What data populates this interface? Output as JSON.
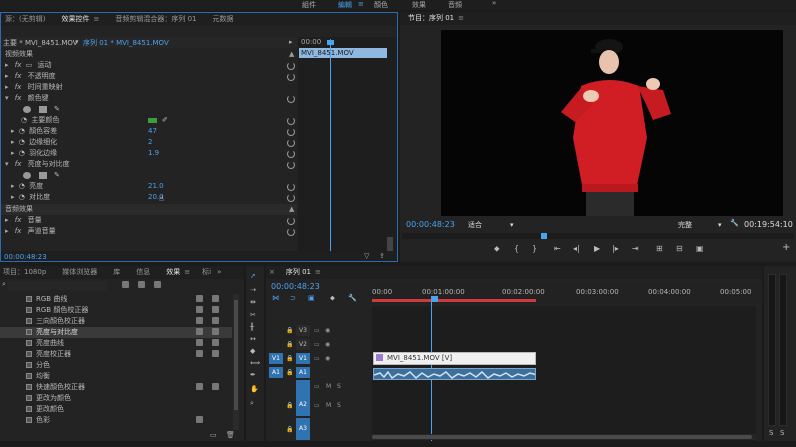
{
  "topbar": {
    "items": [
      "組件",
      "編輯",
      "顏色",
      "效果",
      "音頻"
    ],
    "active": "編輯",
    "more": "»"
  },
  "effect_controls": {
    "tabs": [
      "源：(无剪辑)",
      "效果控件",
      "音频剪辑混合器：序列 01",
      "元数据"
    ],
    "clip_master": "主要 * MVI_8451.MOV",
    "clip_sequence": "序列 01 * MVI_8451.MOV",
    "mini_time": "00:00",
    "mini_clip": "MVI_8451.MOV",
    "section_video": "视频效果",
    "motion": "运动",
    "opacity": "不透明度",
    "time_remap": "时间重映射",
    "color_key": "颜色键",
    "key_color": "主要颜色",
    "color_tolerance": "顏色容差",
    "color_tolerance_val": "47",
    "edge_thin": "边缘细化",
    "edge_thin_val": "2",
    "feather": "羽化边缘",
    "feather_val": "1.9",
    "bc": "亮度与对比度",
    "brightness": "亮度",
    "brightness_val": "21.0",
    "contrast": "对比度",
    "contrast_val": "20.0",
    "section_audio": "音频效果",
    "volume": "音量",
    "channel_volume": "声道音量",
    "timecode": "00:00:48:23"
  },
  "program": {
    "tab": "节目：序列 01",
    "timecode": "00:00:48:23",
    "fit": "适合",
    "quality": "完整",
    "duration": "00:19:54:10"
  },
  "project": {
    "tabs": [
      "项目：1080p",
      "媒体浏览器",
      "库",
      "信息",
      "效果",
      "标i"
    ],
    "search_placeholder": "",
    "items": [
      "RGB 曲线",
      "RGB 顏色校正器",
      "三向顏色校正器",
      "亮度与对比度",
      "亮度曲线",
      "亮度校正器",
      "分色",
      "均衡",
      "快速顏色校正器",
      "更改为颜色",
      "更改颜色",
      "色彩"
    ]
  },
  "timeline": {
    "tab": "序列 01",
    "timecode": "00:00:48:23",
    "ruler": [
      "00:00",
      "00:01:00:00",
      "00:02:00:00",
      "00:03:00:00",
      "00:04:00:00",
      "00:05:00"
    ],
    "tracks_video": [
      "V3",
      "V2",
      "V1"
    ],
    "tracks_audio": [
      "A1",
      "A2",
      "A3"
    ],
    "src_v": "V1",
    "src_a": "A1",
    "clip_label": "MVI_8451.MOV [V]",
    "mute": "M",
    "solo": "S"
  },
  "meter": {
    "labels": [
      "S",
      "S"
    ]
  }
}
